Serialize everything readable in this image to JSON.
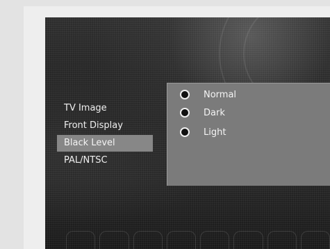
{
  "menu": {
    "items": [
      {
        "label": "TV Image"
      },
      {
        "label": "Front Display"
      },
      {
        "label": "Black Level",
        "selected": true
      },
      {
        "label": "PAL/NTSC"
      }
    ]
  },
  "options": {
    "items": [
      {
        "label": "Normal"
      },
      {
        "label": "Dark"
      },
      {
        "label": "Light"
      }
    ]
  },
  "colors": {
    "selected_item_bg": "#878787",
    "panel_bg": "#7b7b7b",
    "text": "#f0f0f0"
  }
}
